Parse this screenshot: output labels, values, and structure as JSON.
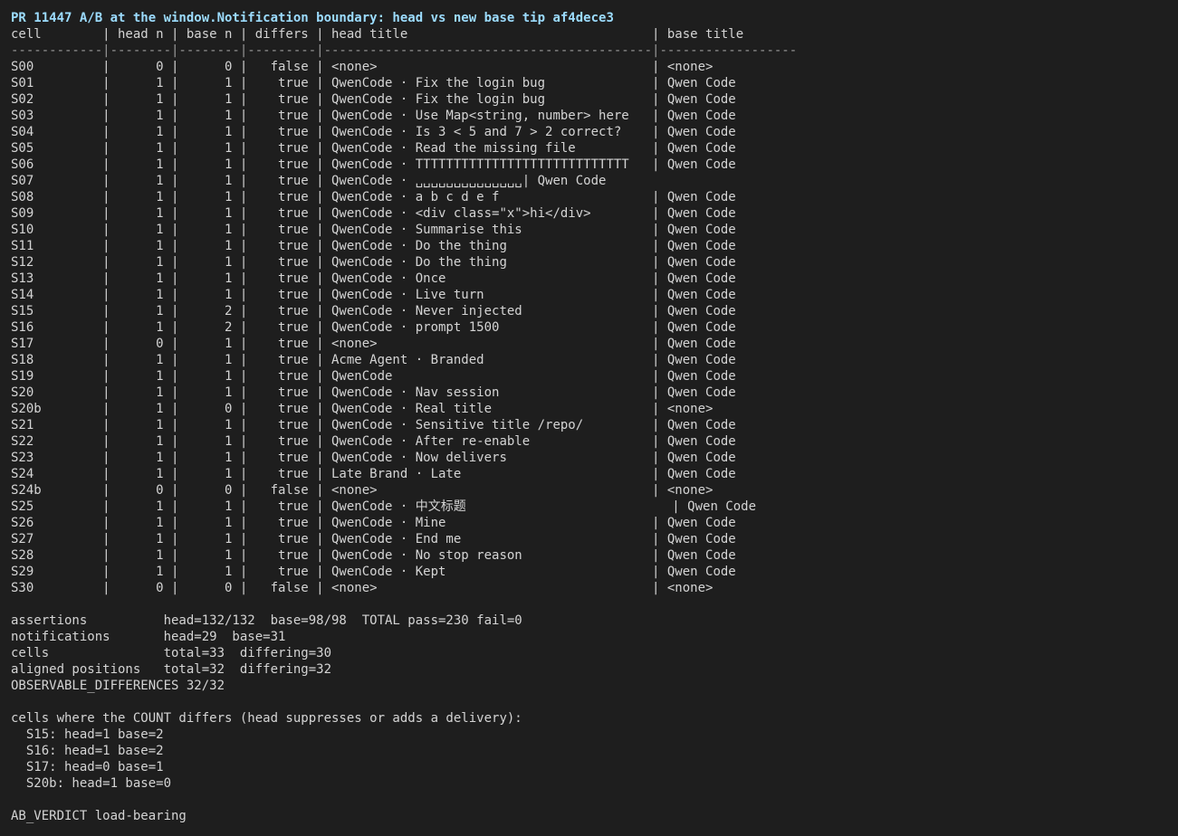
{
  "header": {
    "title": "PR 11447 A/B at the window.Notification boundary: head vs new base tip af4dece3",
    "columns": "cell        | head n | base n | differs | head title                                | base title",
    "separator": "------------|--------|--------|---------|-------------------------------------------|------------------"
  },
  "rows": [
    "S00         |      0 |      0 |   false | <none>                                    | <none>",
    "S01         |      1 |      1 |    true | QwenCode · Fix the login bug              | Qwen Code",
    "S02         |      1 |      1 |    true | QwenCode · Fix the login bug              | Qwen Code",
    "S03         |      1 |      1 |    true | QwenCode · Use Map<string, number> here   | Qwen Code",
    "S04         |      1 |      1 |    true | QwenCode · Is 3 < 5 and 7 > 2 correct?    | Qwen Code",
    "S05         |      1 |      1 |    true | QwenCode · Read the missing file          | Qwen Code",
    "S06         |      1 |      1 |    true | QwenCode · TTTTTTTTTTTTTTTTTTTTTTTTTTTT   | Qwen Code",
    "S07         |      1 |      1 |    true | QwenCode · ␣␣␣␣␣␣␣␣␣␣␣␣␣␣| Qwen Code",
    "S08         |      1 |      1 |    true | QwenCode · a b c d e f                    | Qwen Code",
    "S09         |      1 |      1 |    true | QwenCode · <div class=\"x\">hi</div>        | Qwen Code",
    "S10         |      1 |      1 |    true | QwenCode · Summarise this                 | Qwen Code",
    "S11         |      1 |      1 |    true | QwenCode · Do the thing                   | Qwen Code",
    "S12         |      1 |      1 |    true | QwenCode · Do the thing                   | Qwen Code",
    "S13         |      1 |      1 |    true | QwenCode · Once                           | Qwen Code",
    "S14         |      1 |      1 |    true | QwenCode · Live turn                      | Qwen Code",
    "S15         |      1 |      2 |    true | QwenCode · Never injected                 | Qwen Code",
    "S16         |      1 |      2 |    true | QwenCode · prompt 1500                    | Qwen Code",
    "S17         |      0 |      1 |    true | <none>                                    | Qwen Code",
    "S18         |      1 |      1 |    true | Acme Agent · Branded                      | Qwen Code",
    "S19         |      1 |      1 |    true | QwenCode                                  | Qwen Code",
    "S20         |      1 |      1 |    true | QwenCode · Nav session                    | Qwen Code",
    "S20b        |      1 |      0 |    true | QwenCode · Real title                     | <none>",
    "S21         |      1 |      1 |    true | QwenCode · Sensitive title /repo/         | Qwen Code",
    "S22         |      1 |      1 |    true | QwenCode · After re-enable                | Qwen Code",
    "S23         |      1 |      1 |    true | QwenCode · Now delivers                   | Qwen Code",
    "S24         |      1 |      1 |    true | Late Brand · Late                         | Qwen Code",
    "S24b        |      0 |      0 |   false | <none>                                    | <none>",
    "S25         |      1 |      1 |    true | QwenCode · 中文标题                           | Qwen Code",
    "S26         |      1 |      1 |    true | QwenCode · Mine                           | Qwen Code",
    "S27         |      1 |      1 |    true | QwenCode · End me                         | Qwen Code",
    "S28         |      1 |      1 |    true | QwenCode · No stop reason                 | Qwen Code",
    "S29         |      1 |      1 |    true | QwenCode · Kept                           | Qwen Code",
    "S30         |      0 |      0 |   false | <none>                                    | <none>"
  ],
  "summary": [
    "assertions          head=132/132  base=98/98  TOTAL pass=230 fail=0",
    "notifications       head=29  base=31",
    "cells               total=33  differing=30",
    "aligned positions   total=32  differing=32",
    "OBSERVABLE_DIFFERENCES 32/32"
  ],
  "count_diffs": {
    "heading": "cells where the COUNT differs (head suppresses or adds a delivery):",
    "items": [
      "  S15: head=1 base=2",
      "  S16: head=1 base=2",
      "  S17: head=0 base=1",
      "  S20b: head=1 base=0"
    ]
  },
  "verdict": "AB_VERDICT load-bearing"
}
